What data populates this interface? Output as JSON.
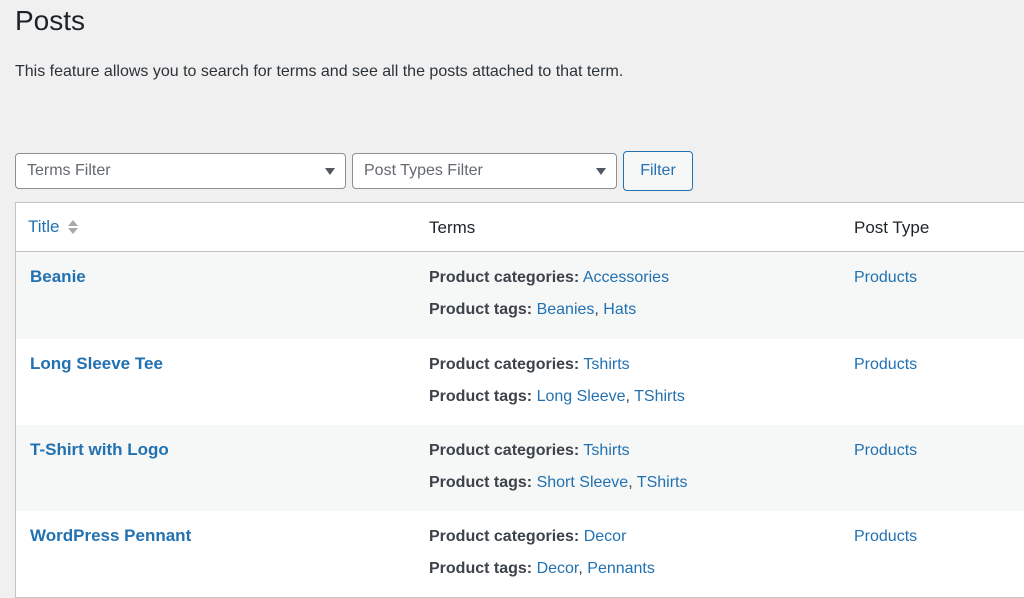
{
  "page": {
    "title": "Posts",
    "description": "This feature allows you to search for terms and see all the posts attached to that term."
  },
  "filters": {
    "terms_placeholder": "Terms Filter",
    "post_types_placeholder": "Post Types Filter",
    "filter_button": "Filter"
  },
  "table": {
    "headers": {
      "title": "Title",
      "terms": "Terms",
      "post_type": "Post Type"
    },
    "rows": [
      {
        "title": "Beanie",
        "categories_label": "Product categories:",
        "categories": [
          "Accessories"
        ],
        "tags_label": "Product tags:",
        "tags": [
          "Beanies",
          "Hats"
        ],
        "post_type": "Products"
      },
      {
        "title": "Long Sleeve Tee",
        "categories_label": "Product categories:",
        "categories": [
          "Tshirts"
        ],
        "tags_label": "Product tags:",
        "tags": [
          "Long Sleeve",
          "TShirts"
        ],
        "post_type": "Products"
      },
      {
        "title": "T-Shirt with Logo",
        "categories_label": "Product categories:",
        "categories": [
          "Tshirts"
        ],
        "tags_label": "Product tags:",
        "tags": [
          "Short Sleeve",
          "TShirts"
        ],
        "post_type": "Products"
      },
      {
        "title": "WordPress Pennant",
        "categories_label": "Product categories:",
        "categories": [
          "Decor"
        ],
        "tags_label": "Product tags:",
        "tags": [
          "Decor",
          "Pennants"
        ],
        "post_type": "Products"
      }
    ]
  },
  "colors": {
    "link": "#2271b1",
    "background": "#f0f0f1",
    "row_alt": "#f6f7f7"
  }
}
